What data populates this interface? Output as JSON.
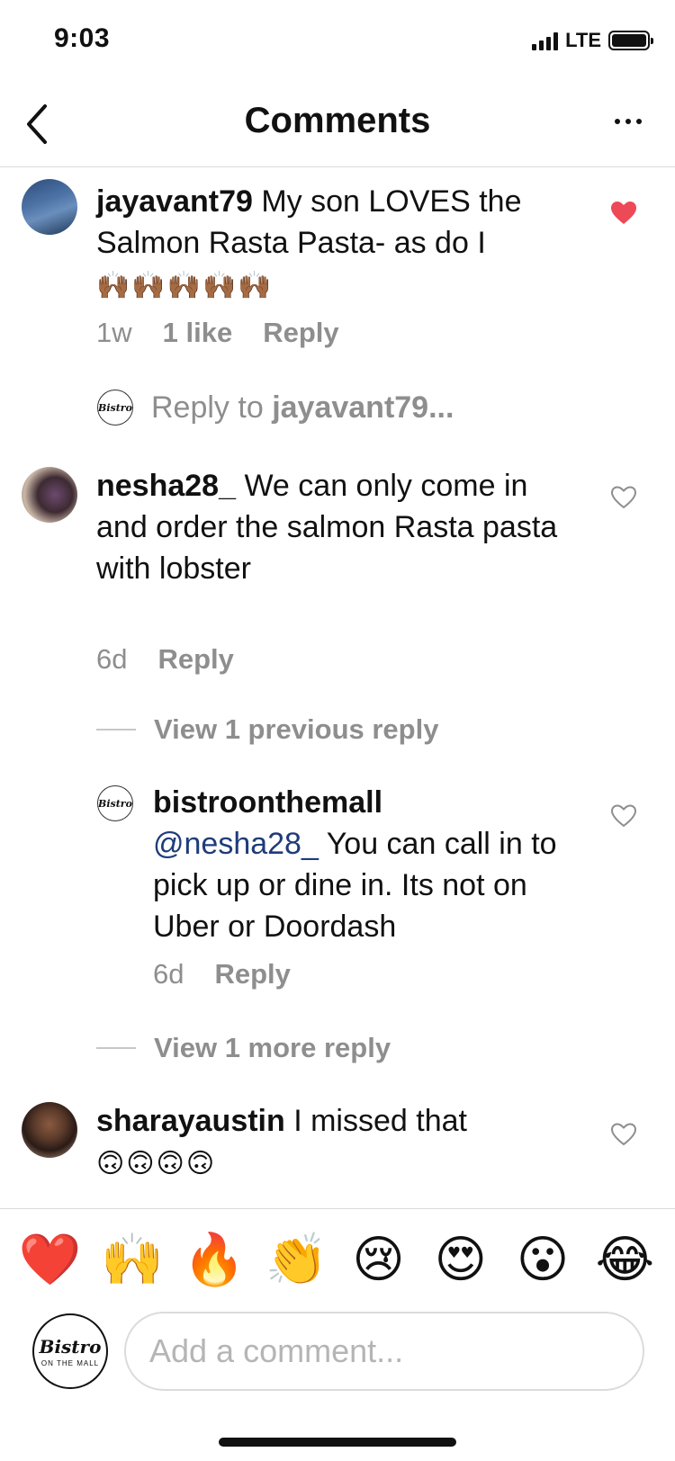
{
  "status": {
    "time": "9:03",
    "network": "LTE"
  },
  "header": {
    "title": "Comments",
    "back_icon": "chevron-left-icon",
    "more_icon": "ellipsis-icon"
  },
  "comments": [
    {
      "username": "jayavant79",
      "text": "My son LOVES the Salmon Rasta Pasta- as do I",
      "emoji": "🙌🏾🙌🏾🙌🏾🙌🏾🙌🏾",
      "age": "1w",
      "likes": "1 like",
      "reply": "Reply",
      "liked": true
    },
    {
      "username": "nesha28_",
      "text": "We can only come in and order the salmon Rasta pasta with lobster",
      "age": "6d",
      "reply": "Reply",
      "liked": false
    },
    {
      "username": "sharayaustin",
      "text": "I missed that",
      "emoji": "🙃🙃🙃🙃",
      "liked": false
    }
  ],
  "reply_prompt": {
    "prefix": "Reply to ",
    "username": "jayavant79..."
  },
  "thread": {
    "view_previous": "View 1 previous reply",
    "view_more": "View 1 more reply",
    "reply": {
      "username": "bistroonthemall",
      "mention": "@nesha28_",
      "text": "You can call in to pick up or dine in. Its not on Uber or Doordash",
      "age": "6d",
      "reply": "Reply",
      "liked": false
    }
  },
  "brand": {
    "logo_text": "Bistro",
    "logo_sub": "ON THE MALL"
  },
  "emoji_bar": [
    "❤️",
    "🙌",
    "🔥",
    "👏",
    "😢",
    "😍",
    "😮",
    "😂"
  ],
  "composer": {
    "placeholder": "Add a comment..."
  },
  "colors": {
    "like_red": "#ed4956",
    "meta_gray": "#8e8e8e",
    "mention_blue": "#1f3c7a"
  }
}
